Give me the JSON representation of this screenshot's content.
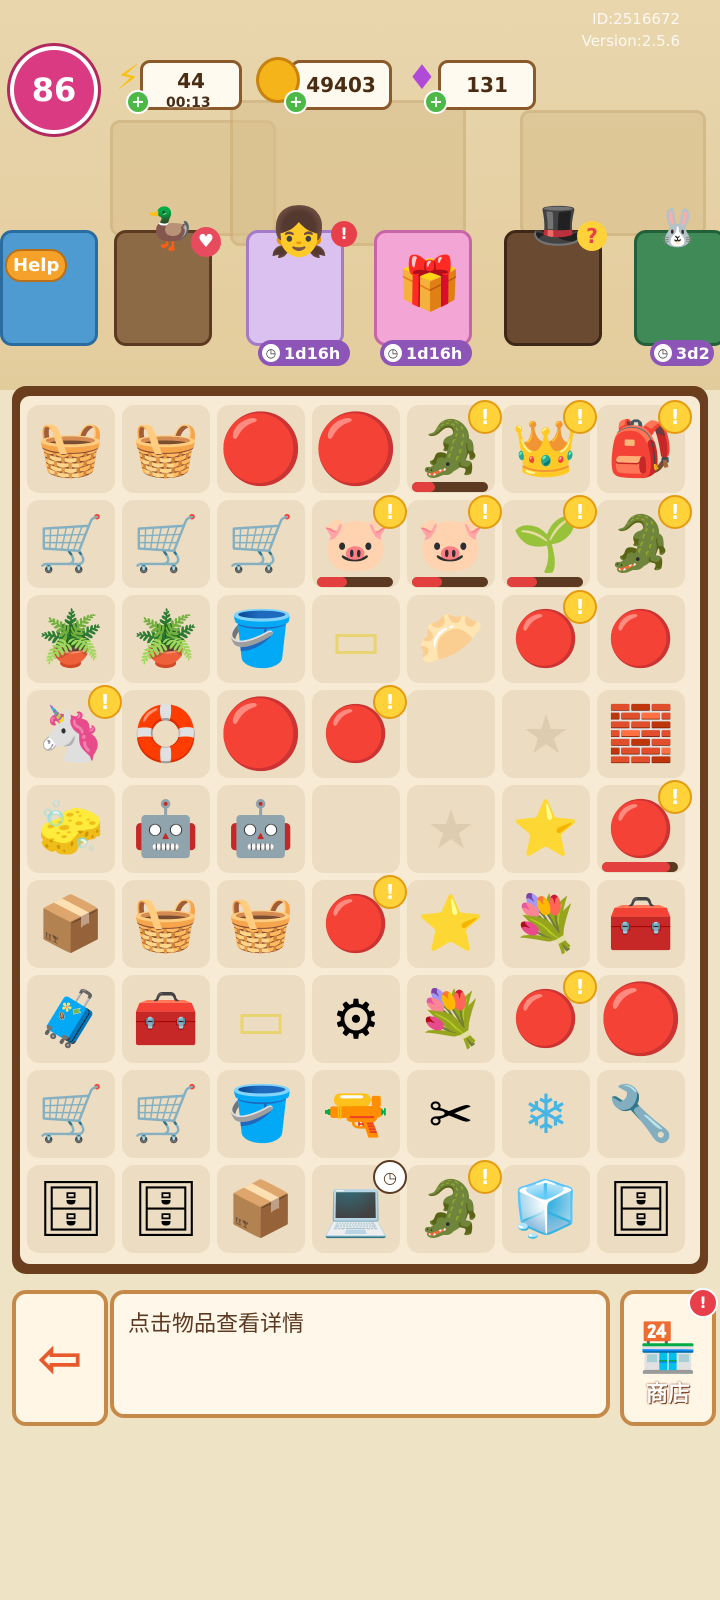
{
  "meta": {
    "id_text": "ID:2516672",
    "version_text": "Version:2.5.6"
  },
  "hud": {
    "level": "86",
    "energy": {
      "value": "44",
      "timer": "00:13",
      "icon": "lightning-icon"
    },
    "coins": {
      "value": "49403",
      "icon": "coin-icon"
    },
    "gems": {
      "value": "131",
      "icon": "gem-icon"
    }
  },
  "characters": [
    {
      "name": "help-sign",
      "label": "Help",
      "timer": ""
    },
    {
      "name": "mailman-duck",
      "label": "",
      "timer": ""
    },
    {
      "name": "girl-customer",
      "label": "",
      "timer": "1d16h"
    },
    {
      "name": "gift-box",
      "label": "",
      "timer": "1d16h"
    },
    {
      "name": "magician-duck",
      "label": "",
      "timer": ""
    },
    {
      "name": "bunny-shop",
      "label": "",
      "timer": "3d2"
    }
  ],
  "board": {
    "rows": [
      [
        {
          "icon": "🧺",
          "n": "flower-basket"
        },
        {
          "icon": "🧺",
          "n": "wicker-basket"
        },
        {
          "icon": "🔴",
          "n": "red-slime-king"
        },
        {
          "icon": "🔴",
          "n": "red-slime-king"
        },
        {
          "icon": "🐊",
          "n": "green-monster",
          "badge": true,
          "bar": 0.3
        },
        {
          "icon": "👑",
          "n": "robot-king",
          "badge": true
        },
        {
          "icon": "🎒",
          "n": "pink-backpack",
          "badge": true
        }
      ],
      [
        {
          "icon": "🛒",
          "n": "duck-cart"
        },
        {
          "icon": "🛒",
          "n": "duck-cart"
        },
        {
          "icon": "🛒",
          "n": "duck-cart"
        },
        {
          "icon": "🐷",
          "n": "purple-pig-monster",
          "badge": true,
          "bar": 0.4
        },
        {
          "icon": "🐷",
          "n": "purple-pig-monster",
          "badge": true,
          "bar": 0.4
        },
        {
          "icon": "🌱",
          "n": "root-monster",
          "badge": true,
          "bar": 0.4
        },
        {
          "icon": "🐊",
          "n": "green-monster",
          "badge": true
        }
      ],
      [
        {
          "icon": "🪴",
          "n": "sprout-pot"
        },
        {
          "icon": "🪴",
          "n": "soil-pot"
        },
        {
          "icon": "🪣",
          "n": "empty-pot"
        },
        {
          "icon": "▭",
          "n": "yellow-frame"
        },
        {
          "icon": "🥟",
          "n": "dumpling-duck"
        },
        {
          "icon": "🔴",
          "n": "red-slime",
          "badge": true
        },
        {
          "icon": "🔴",
          "n": "red-slime"
        }
      ],
      [
        {
          "icon": "🦄",
          "n": "unicorn-float",
          "badge": true
        },
        {
          "icon": "🛟",
          "n": "blue-float"
        },
        {
          "icon": "🔴",
          "n": "red-slime-king"
        },
        {
          "icon": "🔴",
          "n": "red-slime",
          "badge": true
        },
        {
          "icon": "",
          "n": "empty"
        },
        {
          "icon": "★",
          "n": "star-slot"
        },
        {
          "icon": "🧱",
          "n": "bricks"
        }
      ],
      [
        {
          "icon": "🧽",
          "n": "mop-robot"
        },
        {
          "icon": "🤖",
          "n": "robot-vacuum-white"
        },
        {
          "icon": "🤖",
          "n": "robot-vacuum-blue"
        },
        {
          "icon": "",
          "n": "empty"
        },
        {
          "icon": "★",
          "n": "star-slot"
        },
        {
          "icon": "⭐",
          "n": "blue-star-small"
        },
        {
          "icon": "🔴",
          "n": "red-slime",
          "badge": true,
          "bar": 0.9
        }
      ],
      [
        {
          "icon": "📦",
          "n": "box-cart"
        },
        {
          "icon": "🧺",
          "n": "basket-cart"
        },
        {
          "icon": "🧺",
          "n": "dumbbell-basket"
        },
        {
          "icon": "🔴",
          "n": "red-slime",
          "badge": true
        },
        {
          "icon": "⭐",
          "n": "blue-star"
        },
        {
          "icon": "💐",
          "n": "lavender"
        },
        {
          "icon": "🧰",
          "n": "treasure-chest"
        }
      ],
      [
        {
          "icon": "🧳",
          "n": "green-case"
        },
        {
          "icon": "🧰",
          "n": "tool-case"
        },
        {
          "icon": "▭",
          "n": "yellow-tray"
        },
        {
          "icon": "⚙",
          "n": "ab-roller"
        },
        {
          "icon": "💐",
          "n": "flower-vase"
        },
        {
          "icon": "🔴",
          "n": "red-slime",
          "badge": true
        },
        {
          "icon": "🔴",
          "n": "red-slime-king"
        }
      ],
      [
        {
          "icon": "🛒",
          "n": "garden-cart"
        },
        {
          "icon": "🛒",
          "n": "garden-cart"
        },
        {
          "icon": "🪣",
          "n": "tool-bucket"
        },
        {
          "icon": "🔫",
          "n": "drill-saw"
        },
        {
          "icon": "✂",
          "n": "craft-table"
        },
        {
          "icon": "❄",
          "n": "blue-star-big"
        },
        {
          "icon": "🔧",
          "n": "green-drill"
        }
      ],
      [
        {
          "icon": "🗄",
          "n": "locker"
        },
        {
          "icon": "🗄",
          "n": "yellow-locker"
        },
        {
          "icon": "📦",
          "n": "cardboard-box"
        },
        {
          "icon": "💻",
          "n": "laptop",
          "clock": true
        },
        {
          "icon": "🐊",
          "n": "green-monster",
          "badge": true
        },
        {
          "icon": "🧊",
          "n": "blue-cubes"
        },
        {
          "icon": "🗄",
          "n": "yellow-cabinet"
        }
      ]
    ]
  },
  "bottom": {
    "info_text": "点击物品查看详情",
    "shop_label": "商店",
    "exit_icon": "exit-icon"
  }
}
